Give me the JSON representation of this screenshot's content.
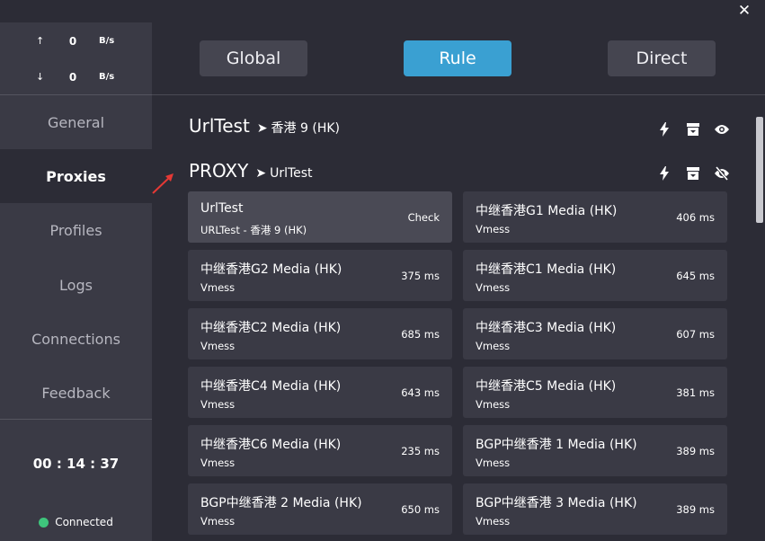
{
  "window": {
    "close_glyph": "✕"
  },
  "traffic": {
    "up": {
      "arrow": "↑",
      "value": "0",
      "unit": "B/s"
    },
    "down": {
      "arrow": "↓",
      "value": "0",
      "unit": "B/s"
    }
  },
  "sidebar": {
    "items": [
      {
        "label": "General"
      },
      {
        "label": "Proxies"
      },
      {
        "label": "Profiles"
      },
      {
        "label": "Logs"
      },
      {
        "label": "Connections"
      },
      {
        "label": "Feedback"
      }
    ],
    "timer": "00 : 14 : 37",
    "status": "Connected",
    "status_color": "#3ec57c"
  },
  "modes": {
    "global": "Global",
    "rule": "Rule",
    "direct": "Direct",
    "active_color": "#3aa0d2"
  },
  "groups": [
    {
      "name": "UrlTest",
      "arrow": "➤",
      "selected": "香港 9 (HK)",
      "icons": [
        "bolt-icon",
        "archive-icon",
        "eye-icon"
      ]
    },
    {
      "name": "PROXY",
      "arrow": "➤",
      "selected": "UrlTest",
      "icons": [
        "bolt-icon",
        "archive-icon",
        "eye-off-icon"
      ]
    }
  ],
  "proxies": [
    {
      "name": "UrlTest",
      "type": "URLTest - 香港 9 (HK)",
      "delay": "Check"
    },
    {
      "name": "中继香港G1 Media (HK)",
      "type": "Vmess",
      "delay": "406 ms"
    },
    {
      "name": "中继香港G2 Media (HK)",
      "type": "Vmess",
      "delay": "375 ms"
    },
    {
      "name": "中继香港C1 Media (HK)",
      "type": "Vmess",
      "delay": "645 ms"
    },
    {
      "name": "中继香港C2 Media (HK)",
      "type": "Vmess",
      "delay": "685 ms"
    },
    {
      "name": "中继香港C3 Media (HK)",
      "type": "Vmess",
      "delay": "607 ms"
    },
    {
      "name": "中继香港C4 Media (HK)",
      "type": "Vmess",
      "delay": "643 ms"
    },
    {
      "name": "中继香港C5 Media (HK)",
      "type": "Vmess",
      "delay": "381 ms"
    },
    {
      "name": "中继香港C6 Media (HK)",
      "type": "Vmess",
      "delay": "235 ms"
    },
    {
      "name": "BGP中继香港 1 Media (HK)",
      "type": "Vmess",
      "delay": "389 ms"
    },
    {
      "name": "BGP中继香港 2 Media (HK)",
      "type": "Vmess",
      "delay": "650 ms"
    },
    {
      "name": "BGP中继香港 3 Media (HK)",
      "type": "Vmess",
      "delay": "389 ms"
    }
  ]
}
